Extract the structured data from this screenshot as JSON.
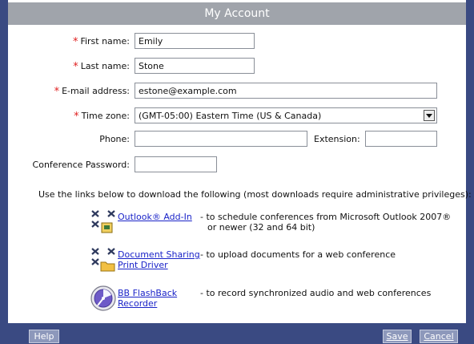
{
  "window": {
    "title": "My Account"
  },
  "form": {
    "first_name_label": "First name:",
    "first_name_value": "Emily",
    "last_name_label": "Last name:",
    "last_name_value": "Stone",
    "email_label": "E-mail address:",
    "email_value": "estone@example.com",
    "timezone_label": "Time zone:",
    "timezone_value": "(GMT-05:00) Eastern Time (US & Canada)",
    "phone_label": "Phone:",
    "phone_value": "",
    "extension_label": "Extension:",
    "extension_value": "",
    "conf_password_label": "Conference Password:",
    "conf_password_value": "",
    "required_marker": "*"
  },
  "downloads": {
    "intro": "Use the links below to download the following (most downloads require administrative privileges):",
    "items": [
      {
        "icon": "outlook-addin-icon",
        "link_line1": "Outlook® Add-In",
        "link_line2": "",
        "desc_line1": "- to schedule conferences from Microsoft Outlook 2007®",
        "desc_line2": "or newer (32 and 64 bit)"
      },
      {
        "icon": "document-sharing-icon",
        "link_line1": "Document Sharing",
        "link_line2": "Print Driver",
        "desc_line1": "- to upload documents for a web conference",
        "desc_line2": ""
      },
      {
        "icon": "flashback-recorder-icon",
        "link_line1": "BB FlashBack",
        "link_line2": "Recorder",
        "desc_line1": "- to record synchronized audio and web conferences",
        "desc_line2": ""
      }
    ]
  },
  "footer": {
    "help_label": "Help",
    "save_label": "Save",
    "cancel_label": "Cancel"
  },
  "colors": {
    "frame": "#3a4a82",
    "titlebar": "#a0a4ab",
    "link": "#1a23c8",
    "required": "#e02020",
    "button": "#8d98bb"
  }
}
